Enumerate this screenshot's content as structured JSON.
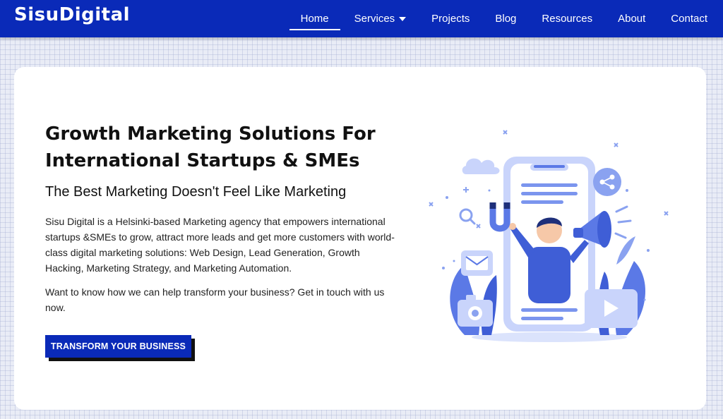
{
  "header": {
    "logo": "SisuDigital",
    "nav": [
      {
        "label": "Home",
        "active": true
      },
      {
        "label": "Services",
        "has_dropdown": true
      },
      {
        "label": "Projects"
      },
      {
        "label": "Blog"
      },
      {
        "label": "Resources"
      },
      {
        "label": "About"
      },
      {
        "label": "Contact"
      }
    ]
  },
  "hero": {
    "headline_line1": "Growth Marketing Solutions For",
    "headline_line2": "International Startups & SMEs",
    "subheadline": "The Best Marketing Doesn't Feel Like Marketing",
    "paragraph1": "Sisu Digital is a Helsinki-based Marketing agency that empowers international startups &SMEs to grow, attract more leads and get more customers with world-class digital marketing solutions: Web Design, Lead Generation, Growth Hacking, Marketing Strategy, and Marketing Automation.",
    "paragraph2": "Want to know how we can help transform your business? Get in touch with us now.",
    "cta_label": "TRANSFORM YOUR BUSINESS"
  },
  "illustration": {
    "icons": [
      "phone-icon",
      "megaphone-icon",
      "share-icon",
      "email-icon",
      "magnet-icon",
      "search-icon",
      "cloud-icon",
      "camera-icon",
      "play-icon"
    ]
  },
  "colors": {
    "brand": "#0a2ab8",
    "illustration_blue": "#5b79e6",
    "illustration_light": "#c9d4fb"
  }
}
